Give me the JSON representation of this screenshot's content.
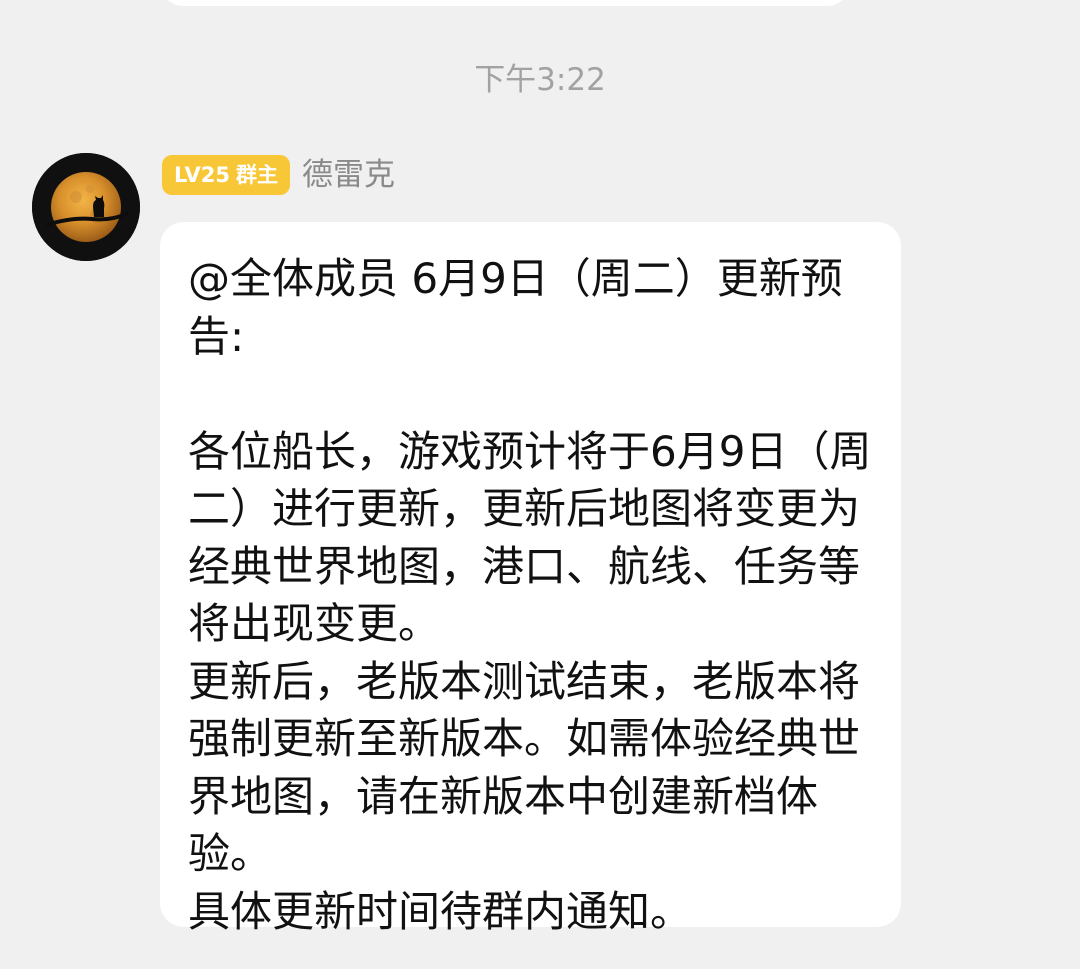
{
  "chat": {
    "timestamp": "下午3:22",
    "message": {
      "sender": {
        "level": "LV25",
        "role": "群主",
        "name": "德雷克",
        "avatar_icon": "moon-cat-avatar"
      },
      "text": "@全体成员 6月9日（周二）更新预告:\n\n各位船长，游戏预计将于6月9日（周二）进行更新，更新后地图将变更为经典世界地图，港口、航线、任务等将出现变更。\n更新后，老版本测试结束，老版本将强制更新至新版本。如需体验经典世界地图，请在新版本中创建新档体验。\n具体更新时间待群内通知。"
    }
  },
  "colors": {
    "background": "#f0f0f0",
    "bubble": "#ffffff",
    "level_badge": "#f7c737",
    "timestamp_text": "#a2a2a2",
    "sender_name_text": "#8a8a8a",
    "message_text": "#111111"
  }
}
